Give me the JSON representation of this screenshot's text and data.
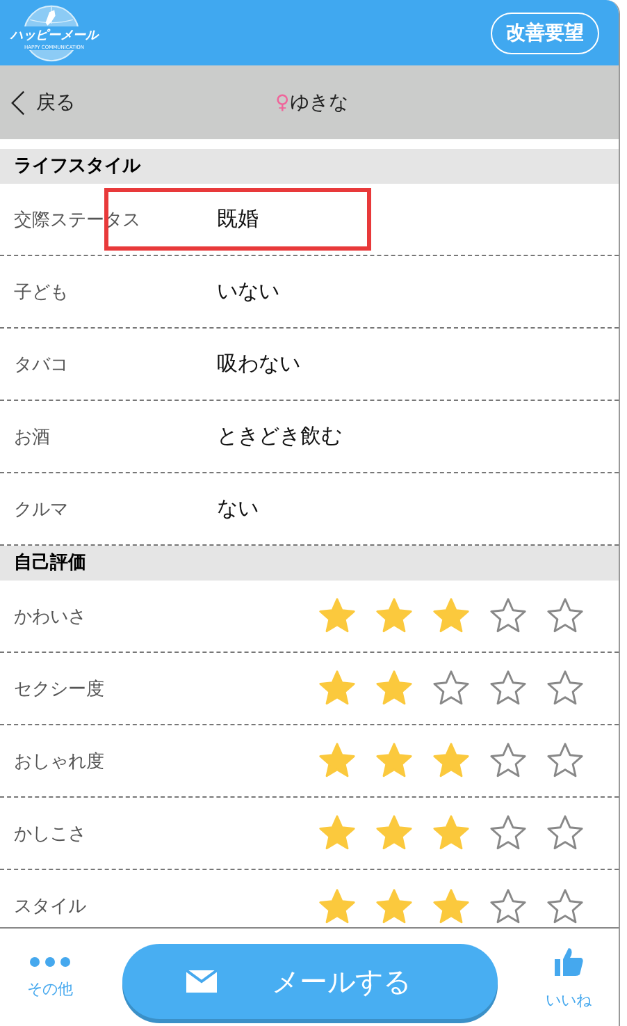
{
  "header": {
    "logo": {
      "name": "ハッピーメール",
      "tagline": "HAPPY COMMUNICATION"
    },
    "request_button": "改善要望"
  },
  "nav": {
    "back": "戻る",
    "gender_symbol": "♀",
    "username": "ゆきな"
  },
  "lifestyle": {
    "title": "ライフスタイル",
    "rows": [
      {
        "label": "交際ステータス",
        "value": "既婚",
        "highlighted": true
      },
      {
        "label": "子ども",
        "value": "いない",
        "highlighted": false
      },
      {
        "label": "タバコ",
        "value": "吸わない",
        "highlighted": false
      },
      {
        "label": "お酒",
        "value": "ときどき飲む",
        "highlighted": false
      },
      {
        "label": "クルマ",
        "value": "ない",
        "highlighted": false
      }
    ]
  },
  "self_rating": {
    "title": "自己評価",
    "rows": [
      {
        "label": "かわいさ",
        "stars": 3
      },
      {
        "label": "セクシー度",
        "stars": 2
      },
      {
        "label": "おしゃれ度",
        "stars": 3
      },
      {
        "label": "かしこさ",
        "stars": 3
      },
      {
        "label": "スタイル",
        "stars": 3
      }
    ]
  },
  "bottom_bar": {
    "more": "その他",
    "mail_button": "メールする",
    "like": "いいね"
  }
}
